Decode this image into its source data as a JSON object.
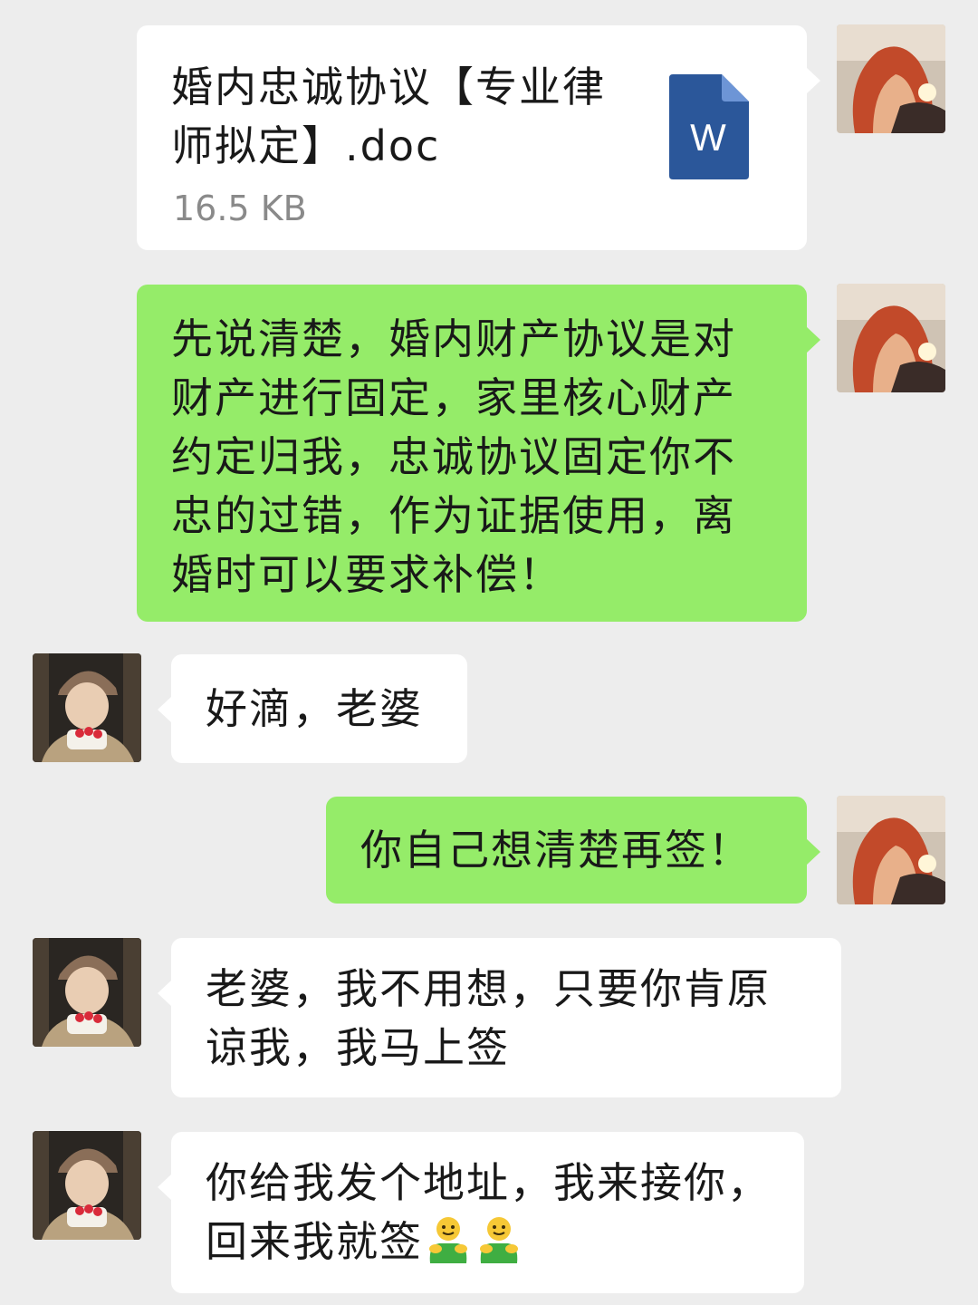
{
  "messages": {
    "file": {
      "name": "婚内忠诚协议【专业律师拟定】.doc",
      "size": "16.5 KB",
      "icon": "word-doc-icon",
      "icon_letter": "W"
    },
    "msg2": "先说清楚，婚内财产协议是对财产进行固定，家里核心财产约定归我，忠诚协议固定你不忠的过错，作为证据使用，离婚时可以要求补偿！",
    "msg3": "好滴，老婆",
    "msg4": "你自己想清楚再签！",
    "msg5": "老婆，我不用想，只要你肯原谅我，我马上签",
    "msg6": "你给我发个地址，我来接你，回来我就签",
    "msg6_emoji": "hug-emoji-icon"
  },
  "colors": {
    "background": "#ededed",
    "my_bubble": "#95ec69",
    "their_bubble": "#ffffff",
    "word_icon": "#2b579a"
  }
}
